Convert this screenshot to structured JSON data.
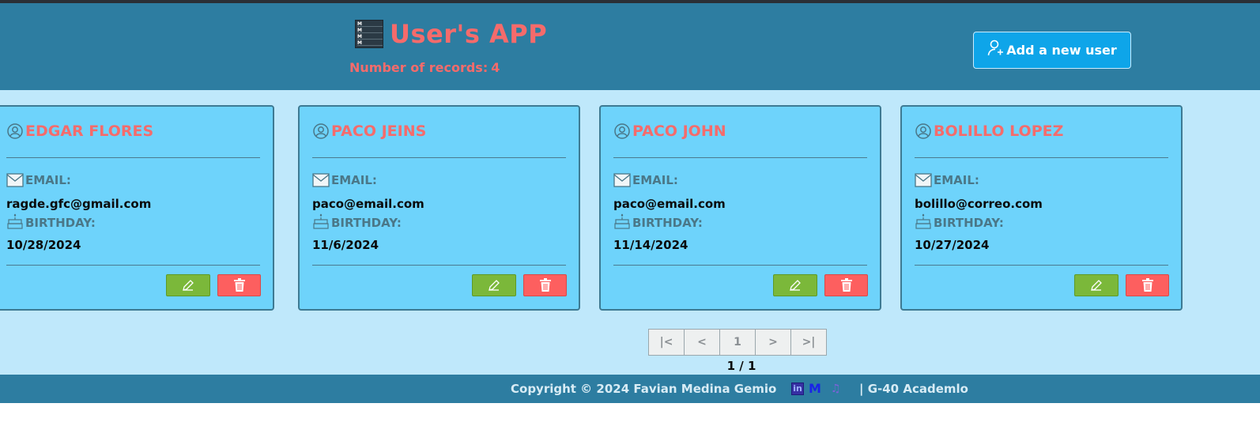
{
  "header": {
    "title": "User's APP",
    "records_label": "Number of records:",
    "records_count": "4",
    "add_button_label": "Add a new user",
    "logo_icon": "database-list-icon"
  },
  "labels": {
    "email": "EMAIL:",
    "birthday": "BIRTHDAY:"
  },
  "users": [
    {
      "name": "EDGAR FLORES",
      "email": "ragde.gfc@gmail.com",
      "birthday": "10/28/2024"
    },
    {
      "name": "PACO JEINS",
      "email": "paco@email.com",
      "birthday": "11/6/2024"
    },
    {
      "name": "PACO JOHN",
      "email": "paco@email.com",
      "birthday": "11/14/2024"
    },
    {
      "name": "BOLILLO LOPEZ",
      "email": "bolillo@correo.com",
      "birthday": "10/27/2024"
    }
  ],
  "pagination": {
    "first": "|<",
    "prev": "<",
    "current": "1",
    "next": ">",
    "last": ">|",
    "page_status": "1 / 1"
  },
  "footer": {
    "copyright": "Copyright © 2024 Favian Medina Gemio",
    "linkedin": "in",
    "medium": "M",
    "academic": "| G-40 Academlo"
  },
  "colors": {
    "header_bg": "#2d7da1",
    "main_bg": "#bfe8fb",
    "card_bg": "#6ed3fb",
    "accent_text": "#f56b6b",
    "edit_button": "#7bb83a",
    "delete_button": "#fd5f5f",
    "add_button": "#0ea5e9"
  }
}
